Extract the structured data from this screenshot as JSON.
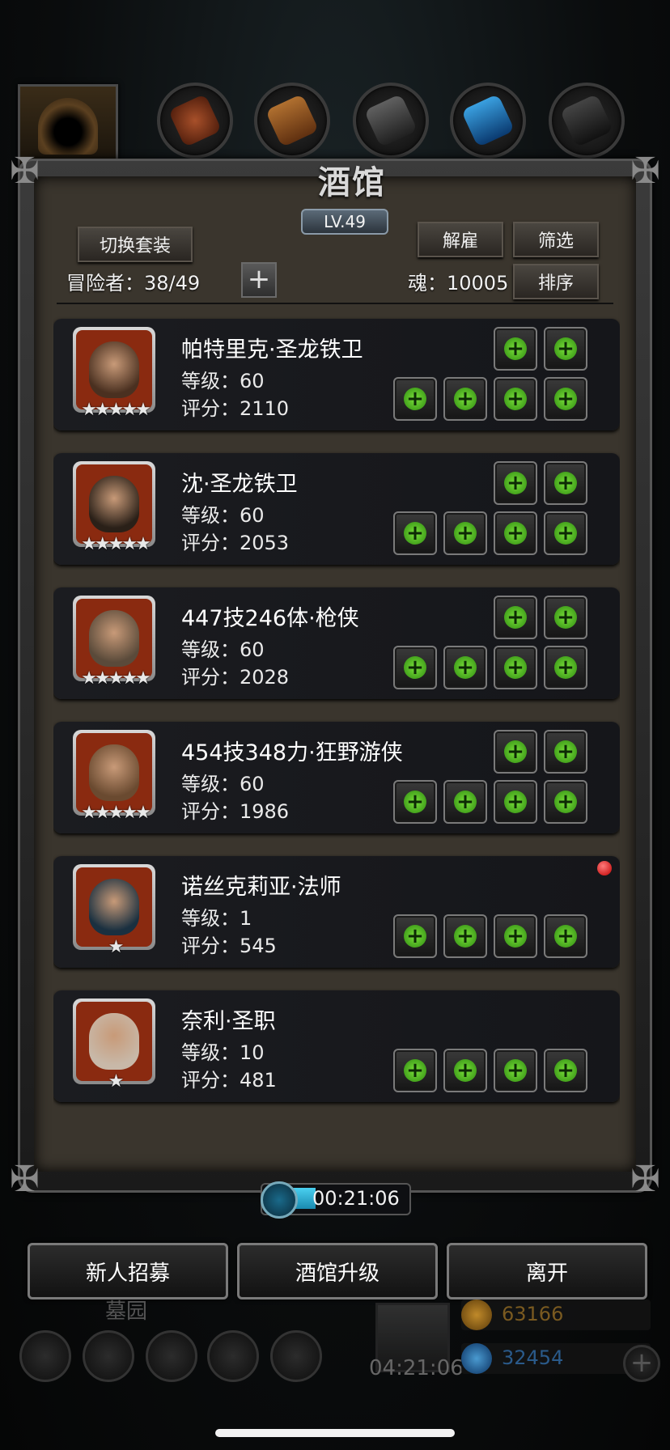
{
  "title": "酒馆",
  "level_badge": "LV.49",
  "buttons": {
    "switch_outfit": "切换套装",
    "dismiss": "解雇",
    "filter": "筛选",
    "sort": "排序",
    "recruit": "新人招募",
    "upgrade": "酒馆升级",
    "leave": "离开"
  },
  "adventurers_label": "冒险者：38/49",
  "soul_label": "魂：10005",
  "heroes": [
    {
      "name": "帕特里克·圣龙铁卫",
      "level": "等级：60",
      "score": "评分：2110",
      "stars": "★★★★★",
      "new": false,
      "extra_slots": true
    },
    {
      "name": "沈·圣龙铁卫",
      "level": "等级：60",
      "score": "评分：2053",
      "stars": "★★★★★",
      "new": false,
      "extra_slots": true
    },
    {
      "name": "447技246体·枪侠",
      "level": "等级：60",
      "score": "评分：2028",
      "stars": "★★★★★",
      "new": false,
      "extra_slots": true
    },
    {
      "name": "454技348力·狂野游侠",
      "level": "等级：60",
      "score": "评分：1986",
      "stars": "★★★★★",
      "new": false,
      "extra_slots": true
    },
    {
      "name": "诺丝克莉亚·法师",
      "level": "等级：1",
      "score": "评分：545",
      "stars": "★",
      "new": true,
      "extra_slots": false
    },
    {
      "name": "奈利·圣职",
      "level": "等级：10",
      "score": "评分：481",
      "stars": "★",
      "new": false,
      "extra_slots": false
    }
  ],
  "timer": "00:21:06",
  "hud": {
    "location": "墓园",
    "chest_timer": "04:21:06",
    "gold": "63166",
    "gems": "32454"
  },
  "colors": {
    "accent_green": "#5ec22a",
    "frame": "#3a3a3a",
    "panel_bg": "#3a352d"
  }
}
